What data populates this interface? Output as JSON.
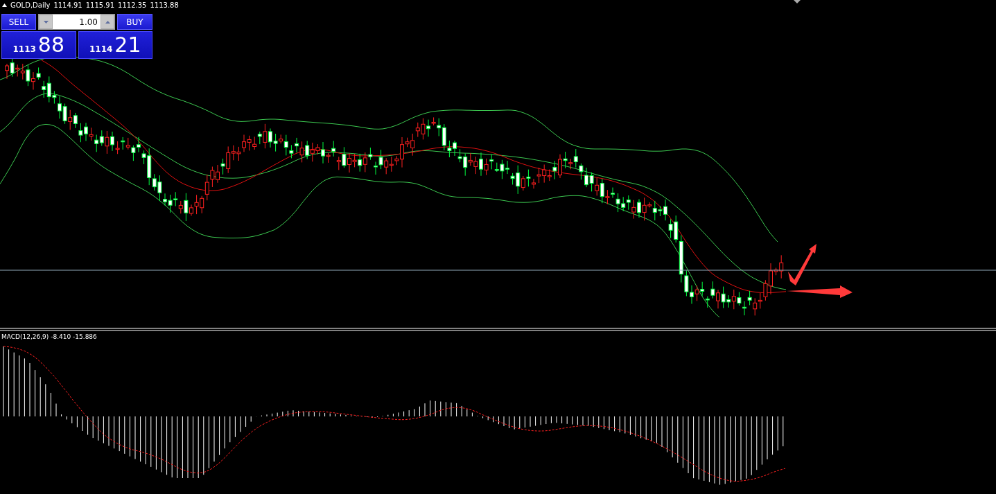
{
  "chart": {
    "symbol": "GOLD,Daily",
    "ohlc": [
      "1114.91",
      "1115.91",
      "1112.35",
      "1113.88"
    ]
  },
  "trade_panel": {
    "sell_label": "SELL",
    "buy_label": "BUY",
    "lot_size": "1.00",
    "sell_price_prefix": "1113",
    "sell_price_main": "88",
    "buy_price_prefix": "1114",
    "buy_price_main": "21"
  },
  "indicator": {
    "label": "MACD(12,26,9) -8.410 -15.886"
  }
}
